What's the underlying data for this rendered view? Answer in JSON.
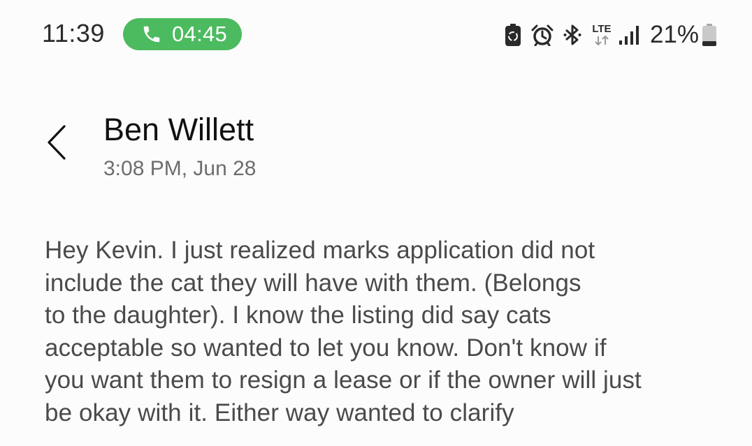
{
  "status_bar": {
    "time": "11:39",
    "call_duration": "04:45",
    "call_color": "#4cbb5f",
    "network": "LTE",
    "battery_percent": "21%",
    "icons": [
      "phone-icon",
      "battery-saver-icon",
      "alarm-icon",
      "bluetooth-icon",
      "lte-icon",
      "signal-icon",
      "battery-icon"
    ]
  },
  "header": {
    "back_icon": "chevron-left-icon",
    "sender_name": "Ben Willett",
    "timestamp": "3:08 PM, Jun 28"
  },
  "message": {
    "lines": [
      "Hey Kevin. I just realized marks application did not",
      "include the cat they will have with them. (Belongs",
      "to the daughter). I know the listing did say cats",
      "acceptable so wanted to let you know. Don't know if",
      "you want them to resign a lease or if the owner will just",
      "be okay with it. Either way wanted to clarify"
    ]
  }
}
